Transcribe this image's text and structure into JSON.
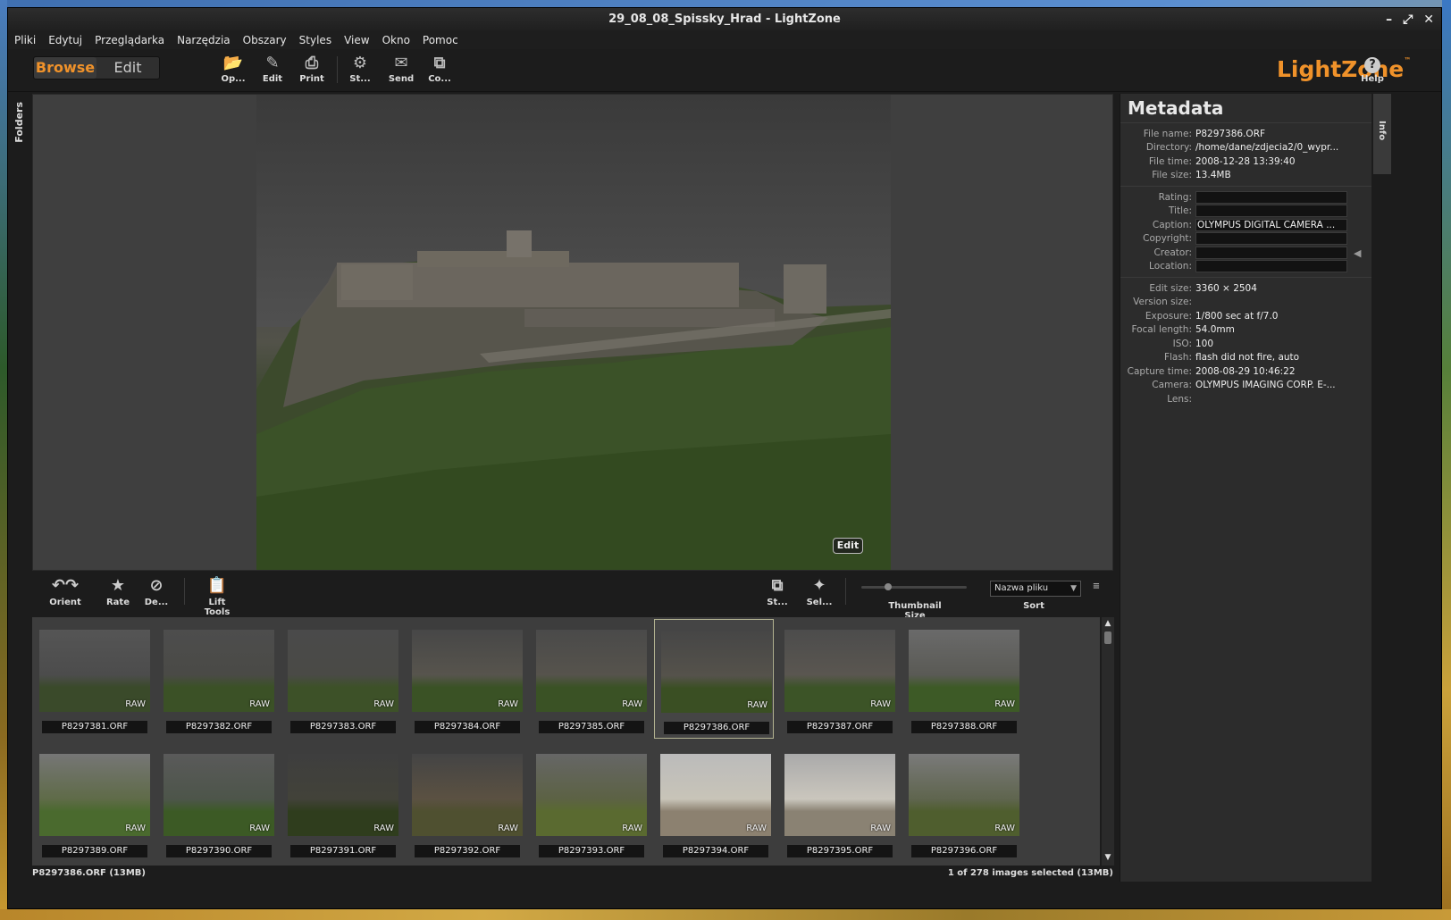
{
  "window": {
    "title": "29_08_08_Spissky_Hrad - LightZone"
  },
  "menu": [
    "Pliki",
    "Edytuj",
    "Przeglądarka",
    "Narzędzia",
    "Obszary",
    "Styles",
    "View",
    "Okno",
    "Pomoc"
  ],
  "mode": {
    "browse": "Browse",
    "edit": "Edit"
  },
  "toolbar": {
    "open": "Op...",
    "edit": "Edit",
    "print": "Print",
    "styles": "St...",
    "send": "Send",
    "convert": "Co...",
    "help": "Help"
  },
  "logo": "LightZone",
  "side_tabs": {
    "folders": "Folders",
    "info": "Info"
  },
  "preview": {
    "edit_badge": "Edit"
  },
  "strip_toolbar": {
    "orient": "Orient",
    "rate": "Rate",
    "delete": "De...",
    "lift_tools": "Lift Tools",
    "styles": "St...",
    "select": "Sel...",
    "thumb_size": "Thumbnail Size",
    "sort": "Sort",
    "sort_value": "Nazwa pliku"
  },
  "thumbnails": [
    {
      "name": "P8297381.ORF",
      "badge": "RAW"
    },
    {
      "name": "P8297382.ORF",
      "badge": "RAW"
    },
    {
      "name": "P8297383.ORF",
      "badge": "RAW"
    },
    {
      "name": "P8297384.ORF",
      "badge": "RAW"
    },
    {
      "name": "P8297385.ORF",
      "badge": "RAW"
    },
    {
      "name": "P8297386.ORF",
      "badge": "RAW"
    },
    {
      "name": "P8297387.ORF",
      "badge": "RAW"
    },
    {
      "name": "P8297388.ORF",
      "badge": "RAW"
    },
    {
      "name": "P8297389.ORF",
      "badge": "RAW"
    },
    {
      "name": "P8297390.ORF",
      "badge": "RAW"
    },
    {
      "name": "P8297391.ORF",
      "badge": "RAW"
    },
    {
      "name": "P8297392.ORF",
      "badge": "RAW"
    },
    {
      "name": "P8297393.ORF",
      "badge": "RAW"
    },
    {
      "name": "P8297394.ORF",
      "badge": "RAW"
    },
    {
      "name": "P8297395.ORF",
      "badge": "RAW"
    },
    {
      "name": "P8297396.ORF",
      "badge": "RAW"
    }
  ],
  "status": {
    "left": "P8297386.ORF (13MB)",
    "right": "1 of 278 images selected (13MB)"
  },
  "metadata": {
    "title": "Metadata",
    "file": [
      {
        "k": "File name:",
        "v": "P8297386.ORF"
      },
      {
        "k": "Directory:",
        "v": "/home/dane/zdjecia2/0_wypr..."
      },
      {
        "k": "File time:",
        "v": "2008-12-28 13:39:40"
      },
      {
        "k": "File size:",
        "v": "13.4MB"
      }
    ],
    "editable": [
      {
        "k": "Rating:",
        "v": ""
      },
      {
        "k": "Title:",
        "v": ""
      },
      {
        "k": "Caption:",
        "v": "OLYMPUS DIGITAL CAMERA      ..."
      },
      {
        "k": "Copyright:",
        "v": ""
      },
      {
        "k": "Creator:",
        "v": ""
      },
      {
        "k": "Location:",
        "v": ""
      }
    ],
    "exif": [
      {
        "k": "Edit size:",
        "v": "3360 × 2504"
      },
      {
        "k": "Version size:",
        "v": ""
      },
      {
        "k": "Exposure:",
        "v": "1/800 sec at f/7.0"
      },
      {
        "k": "Focal length:",
        "v": "54.0mm"
      },
      {
        "k": "ISO:",
        "v": "100"
      },
      {
        "k": "Flash:",
        "v": "flash did not fire, auto"
      },
      {
        "k": "Capture time:",
        "v": "2008-08-29 10:46:22"
      },
      {
        "k": "Camera:",
        "v": "OLYMPUS IMAGING CORP.  E-..."
      },
      {
        "k": "Lens:",
        "v": ""
      }
    ]
  },
  "colors": {
    "accent": "#f0922a",
    "panel": "#2c2c2c",
    "background": "#1c1c1c"
  }
}
